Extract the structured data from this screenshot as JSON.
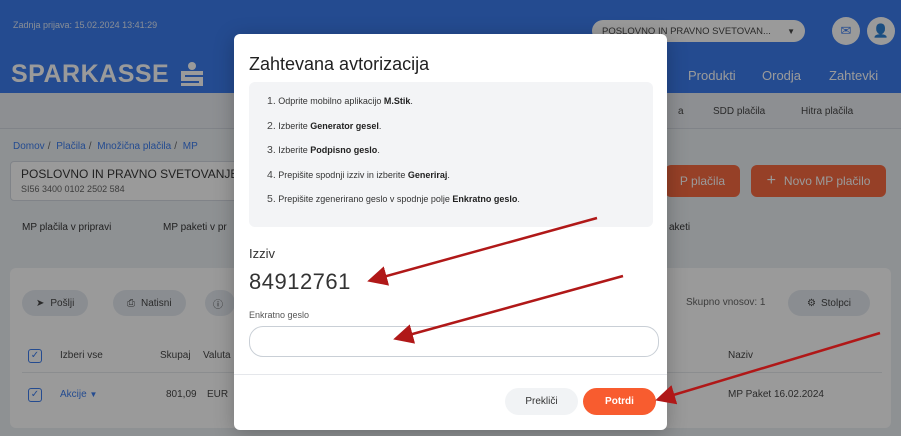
{
  "header": {
    "last_login": "Zadnja prijava: 15.02.2024 13:41:29",
    "company_select": "POSLOVNO IN PRAVNO SVETOVAN...",
    "logo_text": "SPARKASSE",
    "nav": [
      "Produkti",
      "Orodja",
      "Zahtevki"
    ],
    "accent_color": "#2870ed"
  },
  "subnav": [
    "a",
    "SDD plačila",
    "Hitra plačila"
  ],
  "breadcrumb": {
    "home": "Domov",
    "payments": "Plačila",
    "bulk": "Množična plačila",
    "current": "MP"
  },
  "account": {
    "name": "POSLOVNO IN PRAVNO SVETOVANJE",
    "iban": "SI56 3400 0102 2502 584"
  },
  "tabs": [
    "MP plačila v pripravi",
    "MP paketi v pr",
    "aketi"
  ],
  "buttons": {
    "mp_payments": "P plačila",
    "new_mp_payment": "Novo MP plačilo",
    "send": "Pošlji",
    "print": "Natisni",
    "columns": "Stolpci"
  },
  "table": {
    "total_entries": "Skupno vnosov: 1",
    "select_all": "Izberi vse",
    "col_total": "Skupaj",
    "col_currency": "Valuta",
    "col_name": "Naziv",
    "row_actions": "Akcije",
    "row_amount": "801,09",
    "row_currency": "EUR",
    "row_name": "MP Paket 16.02.2024"
  },
  "modal": {
    "title": "Zahtevana avtorizacija",
    "steps": [
      {
        "num": "1.",
        "text": "Odprite mobilno aplikacijo ",
        "bold": "M.Stik",
        "after": "."
      },
      {
        "num": "2.",
        "text": "Izberite ",
        "bold": "Generator gesel",
        "after": "."
      },
      {
        "num": "3.",
        "text": "Izberite ",
        "bold": "Podpisno geslo",
        "after": "."
      },
      {
        "num": "4.",
        "text": "Prepišite spodnji izziv in izberite ",
        "bold": "Generiraj",
        "after": "."
      },
      {
        "num": "5.",
        "text": "Prepišite zgenerirano geslo v spodnje polje ",
        "bold": "Enkratno geslo",
        "after": "."
      }
    ],
    "challenge_label": "Izziv",
    "challenge_value": "84912761",
    "otp_label": "Enkratno geslo",
    "otp_value": "",
    "otp_placeholder": "",
    "cancel_label": "Prekliči",
    "confirm_label": "Potrdi",
    "confirm_color": "#f85c2f",
    "arrow_color": "#b01818"
  }
}
